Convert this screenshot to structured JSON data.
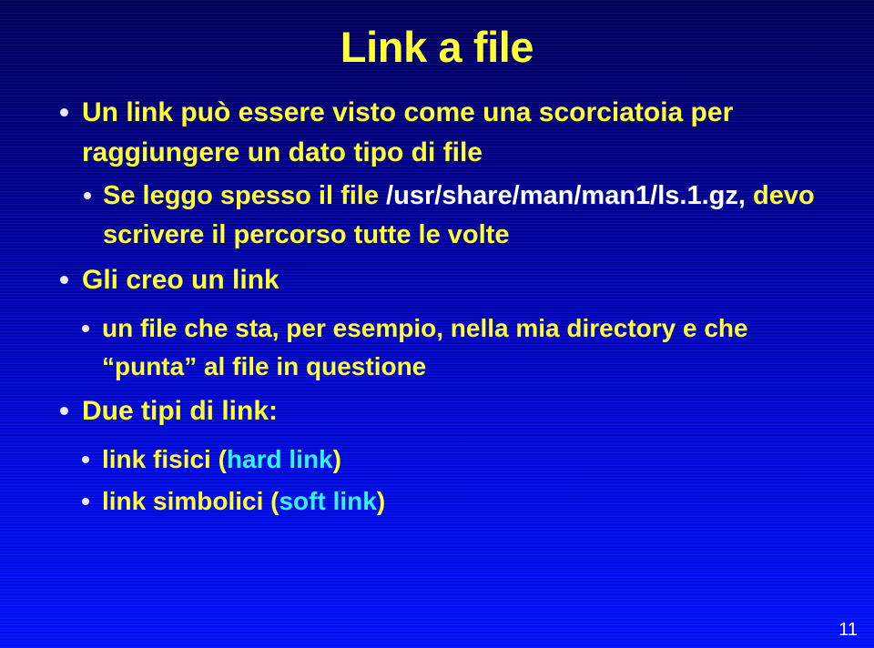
{
  "slide": {
    "title": "Link a file",
    "page_number": "11",
    "colors": {
      "title_text": "#ffff33",
      "body_text": "#ffff33",
      "path_text": "#ffffff",
      "accent_text": "#33f2ff",
      "bullet_dot": "#e9e9f5",
      "background_top": "#00005e",
      "background_bottom": "#0013ff",
      "page_number_text": "#ffffff"
    },
    "bullets": [
      {
        "level": 1,
        "bullet_icon": "bullet-dot-icon",
        "text": "Un link può essere visto come una scorciatoia per raggiungere un dato tipo di file"
      },
      {
        "level": 2,
        "bullet_icon": "bullet-dot-icon",
        "text_lead": "Se leggo spesso il file ",
        "text_path": "/usr/share/man/man1/ls.1.gz,",
        "text_tail": " devo scrivere il percorso tutte le volte"
      },
      {
        "level": 1,
        "bullet_icon": "bullet-dot-icon",
        "text": "Gli creo un link"
      },
      {
        "level": 3,
        "bullet_icon": "bullet-dot-icon",
        "text": "un file che sta, per esempio, nella mia directory e che “punta” al file in questione"
      },
      {
        "level": 1,
        "bullet_icon": "bullet-dot-icon",
        "text": "Due tipi di link:"
      },
      {
        "level": 3,
        "bullet_icon": "bullet-dot-icon",
        "text_lead": "link fisici (",
        "text_accent": "hard link",
        "text_tail": ")"
      },
      {
        "level": 3,
        "bullet_icon": "bullet-dot-icon",
        "text_lead": "link simbolici (",
        "text_accent": "soft link",
        "text_tail": ")"
      }
    ]
  }
}
